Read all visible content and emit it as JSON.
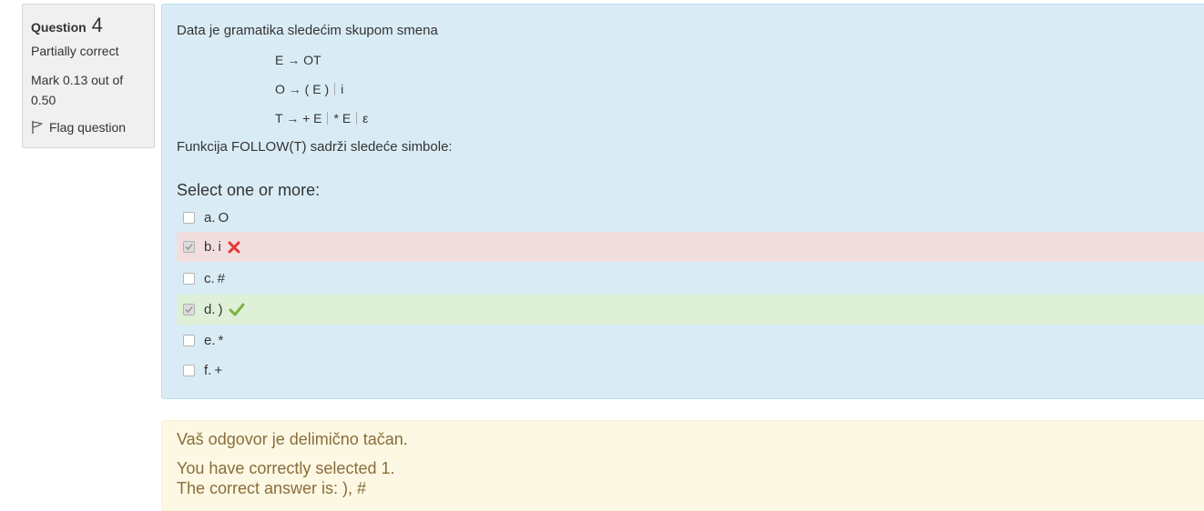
{
  "question_info": {
    "label": "Question",
    "number": "4",
    "state": "Partially correct",
    "grade_line1": "Mark 0.13 out of",
    "grade_line2": "0.50",
    "flag_label": "Flag question",
    "flag_icon": "flag-icon"
  },
  "question": {
    "intro": "Data je gramatika sledećim skupom smena",
    "rules": [
      {
        "parts": [
          "E → OT"
        ]
      },
      {
        "parts": [
          "O → ( E )",
          "i"
        ]
      },
      {
        "parts": [
          "T → + E",
          "* E",
          "ε"
        ]
      }
    ],
    "follow_text": "Funkcija FOLLOW(T) sadrži sledeće simbole:",
    "prompt": "Select one or more:"
  },
  "options": [
    {
      "letter": "a.",
      "text": "O",
      "checked": false,
      "status": "none"
    },
    {
      "letter": "b.",
      "text": "i",
      "checked": true,
      "status": "incorrect"
    },
    {
      "letter": "c.",
      "text": "#",
      "checked": false,
      "status": "none"
    },
    {
      "letter": "d.",
      "text": ")",
      "checked": true,
      "status": "correct"
    },
    {
      "letter": "e.",
      "text": "*",
      "checked": false,
      "status": "none"
    },
    {
      "letter": "f.",
      "text": "+",
      "checked": false,
      "status": "none"
    }
  ],
  "feedback": {
    "specific": "Vaš odgovor je delimično tačan.",
    "selected_correct": "You have correctly selected 1.",
    "right_answer": "The correct answer is: ), #"
  },
  "colors": {
    "formulation_bg": "#d9ecf5",
    "incorrect_bg": "#f2dede",
    "correct_bg": "#dff0d8",
    "outcome_bg": "#fcf8e3",
    "incorrect_icon": "#e53935",
    "correct_icon": "#7cb342"
  }
}
